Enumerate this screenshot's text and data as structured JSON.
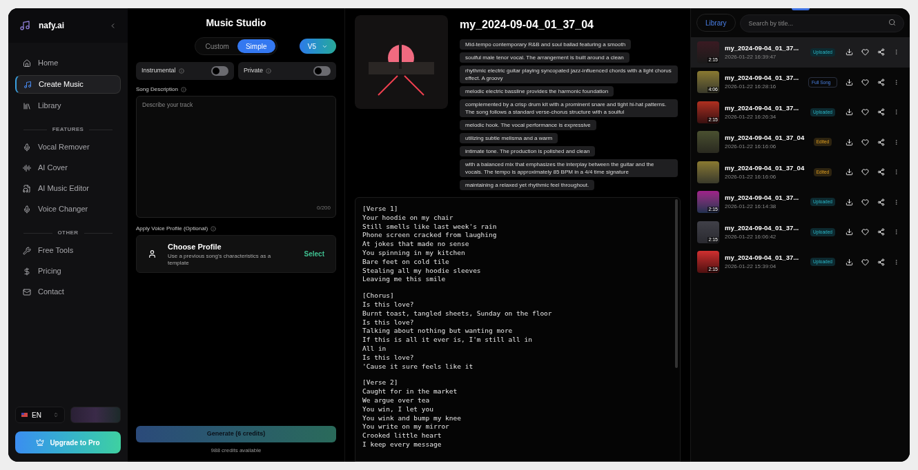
{
  "sidebar": {
    "brand": "nafy.ai",
    "main": [
      {
        "label": "Home",
        "selected": false
      },
      {
        "label": "Create Music",
        "selected": true
      },
      {
        "label": "Library",
        "selected": false
      }
    ],
    "sections": [
      {
        "title": "FEATURES",
        "items": [
          {
            "label": "Vocal Remover",
            "selected": false
          },
          {
            "label": "AI Cover",
            "selected": false
          },
          {
            "label": "AI Music Editor",
            "selected": false
          },
          {
            "label": "Voice Changer",
            "selected": false
          }
        ]
      },
      {
        "title": "OTHER",
        "items": [
          {
            "label": "Free Tools",
            "selected": false
          },
          {
            "label": "Pricing",
            "selected": false
          },
          {
            "label": "Contact",
            "selected": false
          }
        ]
      }
    ],
    "language": "EN",
    "upgrade": "Upgrade to Pro"
  },
  "studio": {
    "title": "Music Studio",
    "modes": [
      {
        "label": "Custom",
        "selected": false
      },
      {
        "label": "Simple",
        "selected": true
      }
    ],
    "version": "V5",
    "toggles": [
      {
        "label": "Instrumental",
        "on": false
      },
      {
        "label": "Private",
        "on": false
      }
    ],
    "description": {
      "label": "Song Description",
      "placeholder": "Describe your track",
      "counter": "0/200"
    },
    "voice_profile": {
      "label": "Apply Voice Profile (Optional)",
      "title": "Choose Profile",
      "subtitle": "Use a previous song's characteristics as a template",
      "action": "Select"
    },
    "generate": {
      "label": "Generate (6 credits)",
      "disabled": true
    },
    "credits": "988 credits available"
  },
  "song": {
    "title": "my_2024-09-04_01_37_04",
    "tags": [
      "Mid-tempo contemporary R&B and soul ballad featuring a smooth",
      "soulful male tenor vocal. The arrangement is built around a clean",
      "rhythmic electric guitar playing syncopated jazz-influenced chords with a light chorus effect. A groovy",
      "melodic electric bassline provides the harmonic foundation",
      "complemented by a crisp drum kit with a prominent snare and tight hi-hat patterns. The song follows a standard verse-chorus structure with a soulful",
      "melodic hook. The vocal performance is expressive",
      "utilizing subtle melisma and a warm",
      "intimate tone. The production is polished and clean",
      "with a balanced mix that emphasizes the interplay between the guitar and the vocals. The tempo is approximately 85 BPM in a 4/4 time signature",
      "maintaining a relaxed yet rhythmic feel throughout."
    ],
    "lyrics": [
      {
        "lines": [
          "[Verse 1]",
          "Your hoodie on my chair",
          "Still smells like last week's rain",
          "Phone screen cracked from laughing",
          "At jokes that made no sense",
          "You spinning in my kitchen",
          "Bare feet on cold tile",
          "Stealing all my hoodie sleeves",
          "Leaving me this smile"
        ]
      },
      {
        "lines": [
          "[Chorus]",
          "Is this love?",
          "Burnt toast, tangled sheets, Sunday on the floor",
          "Is this love?",
          "Talking about nothing but wanting more",
          "If this is all it ever is, I'm still all in",
          "All in",
          "Is this love?",
          "'Cause it sure feels like it"
        ]
      },
      {
        "lines": [
          "[Verse 2]",
          "Caught for in the market",
          "We argue over tea",
          "You win, I let you",
          "You wink and bump my knee",
          "You write on my mirror",
          "Crooked little heart",
          "I keep every message"
        ]
      }
    ]
  },
  "library": {
    "tab": "Library",
    "search_placeholder": "Search by title...",
    "items": [
      {
        "title": "my_2024-09-04_01_37...",
        "date": "2026-01-22 16:39:47",
        "duration": "2:15",
        "badge": {
          "label": "Uploaded",
          "kind": "uploaded"
        },
        "selected": true
      },
      {
        "title": "my_2024-09-04_01_37...",
        "date": "2026-01-22 16:28:16",
        "duration": "4:06",
        "badge": {
          "label": "Full Song",
          "kind": "full"
        },
        "selected": false
      },
      {
        "title": "my_2024-09-04_01_37...",
        "date": "2026-01-22 16:26:34",
        "duration": "2:15",
        "badge": {
          "label": "Uploaded",
          "kind": "uploaded"
        },
        "selected": false
      },
      {
        "title": "my_2024-09-04_01_37_04",
        "date": "2026-01-22 16:16:06",
        "badge": {
          "label": "Edited",
          "kind": "edited"
        },
        "selected": false
      },
      {
        "title": "my_2024-09-04_01_37_04",
        "date": "2026-01-22 16:16:06",
        "badge": {
          "label": "Edited",
          "kind": "edited"
        },
        "selected": false
      },
      {
        "title": "my_2024-09-04_01_37...",
        "date": "2026-01-22 16:14:38",
        "duration": "2:15",
        "badge": {
          "label": "Uploaded",
          "kind": "uploaded"
        },
        "selected": false
      },
      {
        "title": "my_2024-09-04_01_37...",
        "date": "2026-01-22 16:06:42",
        "duration": "2:15",
        "badge": {
          "label": "Uploaded",
          "kind": "uploaded"
        },
        "selected": false
      },
      {
        "title": "my_2024-09-04_01_37...",
        "date": "2026-01-22 15:39:04",
        "duration": "2:15",
        "badge": {
          "label": "Uploaded",
          "kind": "uploaded"
        },
        "selected": false
      }
    ]
  }
}
